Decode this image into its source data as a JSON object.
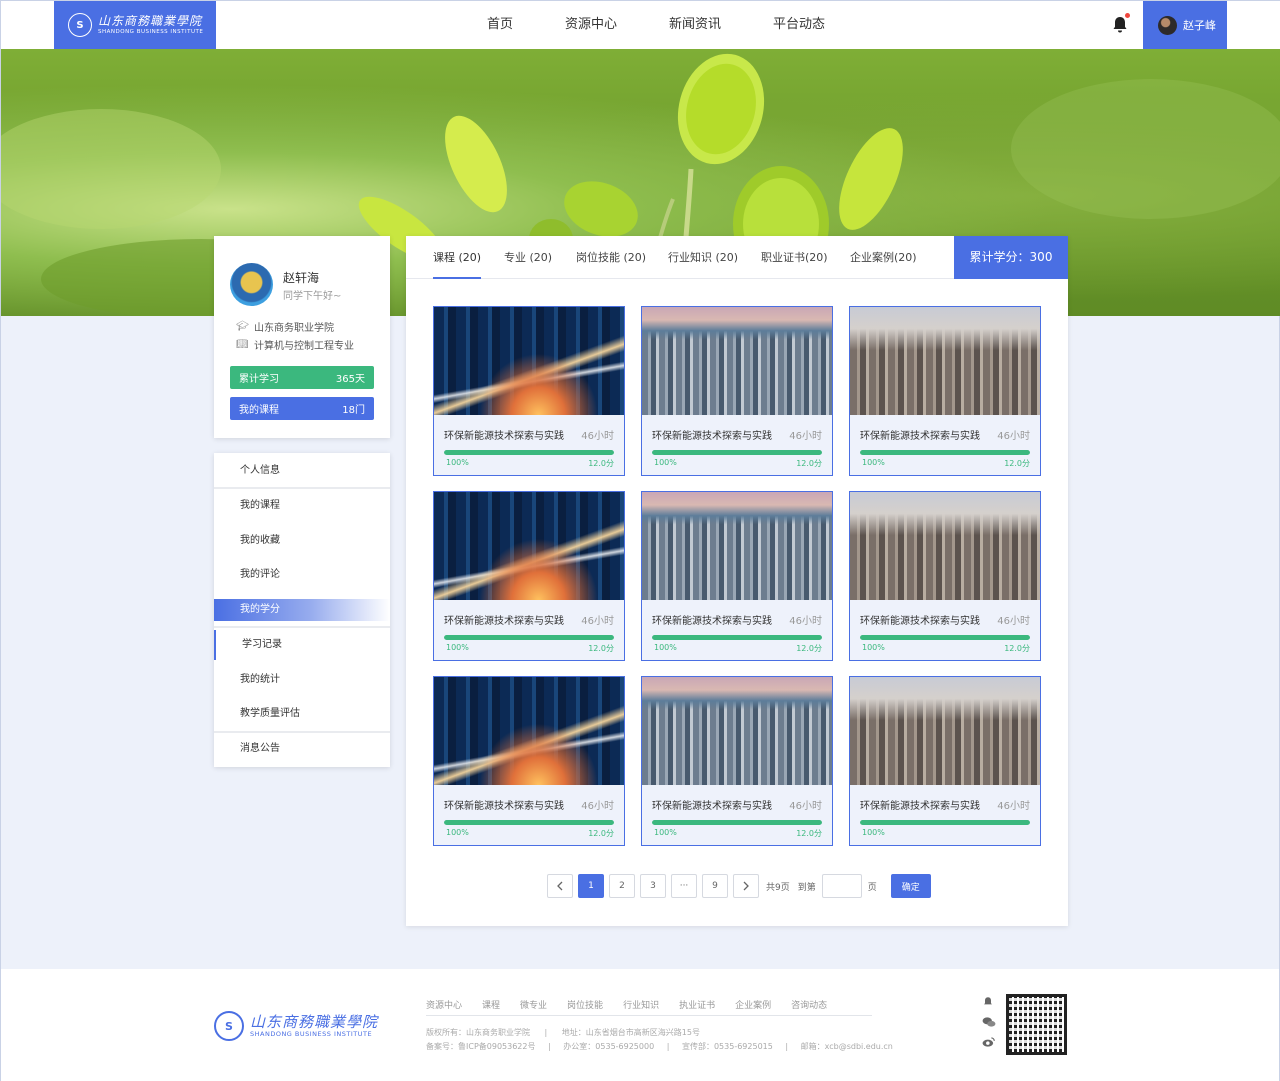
{
  "header": {
    "logo_cn": "山东商務職業學院",
    "logo_en": "SHANDONG BUSINESS INSTITUTE",
    "nav": [
      "首页",
      "资源中心",
      "新闻资讯",
      "平台动态"
    ],
    "user_name": "赵子峰"
  },
  "profile": {
    "name": "赵轩海",
    "greeting": "同学下午好~",
    "school": "山东商务职业学院",
    "major": "计算机与控制工程专业",
    "stats": [
      {
        "label": "累计学习",
        "value": "365天"
      },
      {
        "label": "我的课程",
        "value": "18门"
      }
    ]
  },
  "menu": [
    "个人信息",
    "我的课程",
    "我的收藏",
    "我的评论",
    "我的学分",
    "学习记录",
    "我的统计",
    "教学质量评估",
    "消息公告"
  ],
  "tabs": [
    "课程 (20)",
    "专业 (20)",
    "岗位技能 (20)",
    "行业知识 (20)",
    "职业证书(20)",
    "企业案例(20)"
  ],
  "total_credits": "累计学分：300",
  "courses": [
    {
      "title": "环保新能源技术探索与实践",
      "hours": "46小时",
      "progress": "100%",
      "progress_value": 1.0,
      "score": "12.0分"
    },
    {
      "title": "环保新能源技术探索与实践",
      "hours": "46小时",
      "progress": "100%",
      "progress_value": 1.0,
      "score": "12.0分"
    },
    {
      "title": "环保新能源技术探索与实践",
      "hours": "46小时",
      "progress": "100%",
      "progress_value": 1.0,
      "score": "12.0分"
    },
    {
      "title": "环保新能源技术探索与实践",
      "hours": "46小时",
      "progress": "100%",
      "progress_value": 1.0,
      "score": "12.0分"
    },
    {
      "title": "环保新能源技术探索与实践",
      "hours": "46小时",
      "progress": "100%",
      "progress_value": 1.0,
      "score": "12.0分"
    },
    {
      "title": "环保新能源技术探索与实践",
      "hours": "46小时",
      "progress": "100%",
      "progress_value": 1.0,
      "score": "12.0分"
    },
    {
      "title": "环保新能源技术探索与实践",
      "hours": "46小时",
      "progress": "100%",
      "progress_value": 1.0,
      "score": "12.0分"
    },
    {
      "title": "环保新能源技术探索与实践",
      "hours": "46小时",
      "progress": "100%",
      "progress_value": 1.0,
      "score": "12.0分"
    },
    {
      "title": "环保新能源技术探索与实践",
      "hours": "46小时",
      "progress": "100%",
      "progress_value": 1.0,
      "score": ""
    }
  ],
  "pagination": {
    "pages": [
      "1",
      "2",
      "3",
      "···",
      "9"
    ],
    "total": "共9页",
    "goto": "到第",
    "page_unit": "页",
    "confirm": "确定"
  },
  "footer": {
    "links": [
      "资源中心",
      "课程",
      "微专业",
      "岗位技能",
      "行业知识",
      "执业证书",
      "企业案例",
      "咨询动态"
    ],
    "copyright": "版权所有：山东商务职业学院",
    "address": "地址：山东省烟台市高新区海兴路15号",
    "icp": "备案号：鲁ICP备09053622号",
    "office": "办公室：0535-6925000",
    "publicity": "宣传部：0535-6925015",
    "email": "邮箱：xcb@sdbi.edu.cn"
  },
  "colors": {
    "accent": "#4a6fe3",
    "success": "#3bb87e"
  }
}
